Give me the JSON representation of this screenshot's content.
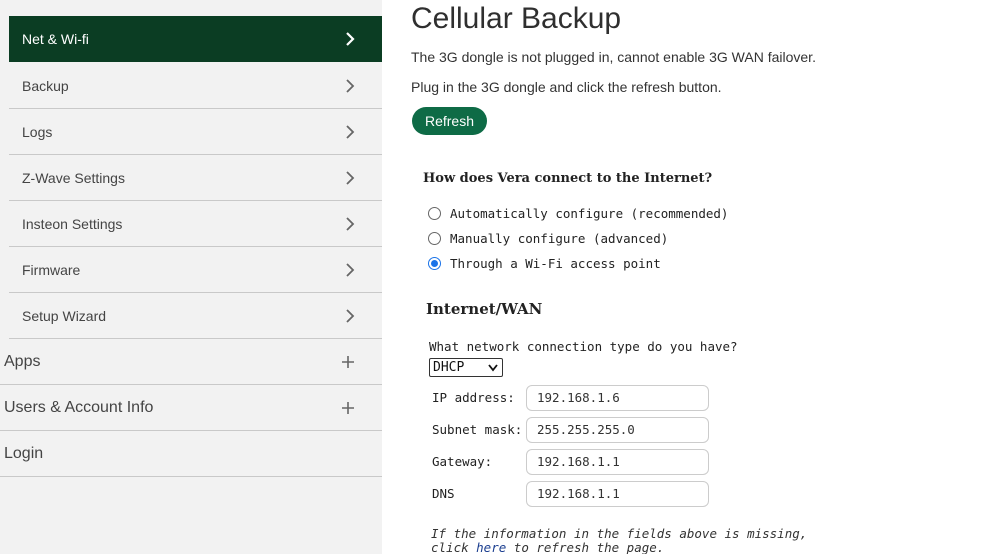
{
  "sidebar": {
    "sub_items": [
      {
        "label": "Net & Wi-fi",
        "active": true
      },
      {
        "label": "Backup"
      },
      {
        "label": "Logs"
      },
      {
        "label": "Z-Wave Settings"
      },
      {
        "label": "Insteon Settings"
      },
      {
        "label": "Firmware"
      },
      {
        "label": "Setup Wizard"
      }
    ],
    "top_items": [
      {
        "label": "Apps"
      },
      {
        "label": "Users & Account Info"
      },
      {
        "label": "Login"
      }
    ]
  },
  "main": {
    "title": "Cellular Backup",
    "message1": "The 3G dongle is not plugged in, cannot enable 3G WAN failover.",
    "message2": "Plug in the 3G dongle and click the refresh button.",
    "refresh_label": "Refresh",
    "question": "How does Vera connect to the Internet?",
    "options": [
      {
        "label": "Automatically configure (recommended)",
        "checked": false
      },
      {
        "label": "Manually configure (advanced)",
        "checked": false
      },
      {
        "label": "Through a Wi-Fi access point",
        "checked": true
      }
    ],
    "section_title": "Internet/WAN",
    "connection_question": "What network connection type do you have?",
    "connection_type": "DHCP",
    "fields": [
      {
        "label": "IP address:",
        "value": "192.168.1.6"
      },
      {
        "label": "Subnet mask:",
        "value": "255.255.255.0"
      },
      {
        "label": "Gateway:",
        "value": "192.168.1.1"
      },
      {
        "label": "DNS",
        "value": "192.168.1.1"
      }
    ],
    "note_line1": "If the information in the fields above is missing,",
    "note_prefix": "click ",
    "note_link": "here",
    "note_suffix": " to refresh the page."
  },
  "colors": {
    "active_bg": "#0b3d23",
    "button_bg": "#0e6b46",
    "radio_checked": "#1a73e8",
    "sidebar_bg": "#f2f2f2"
  }
}
